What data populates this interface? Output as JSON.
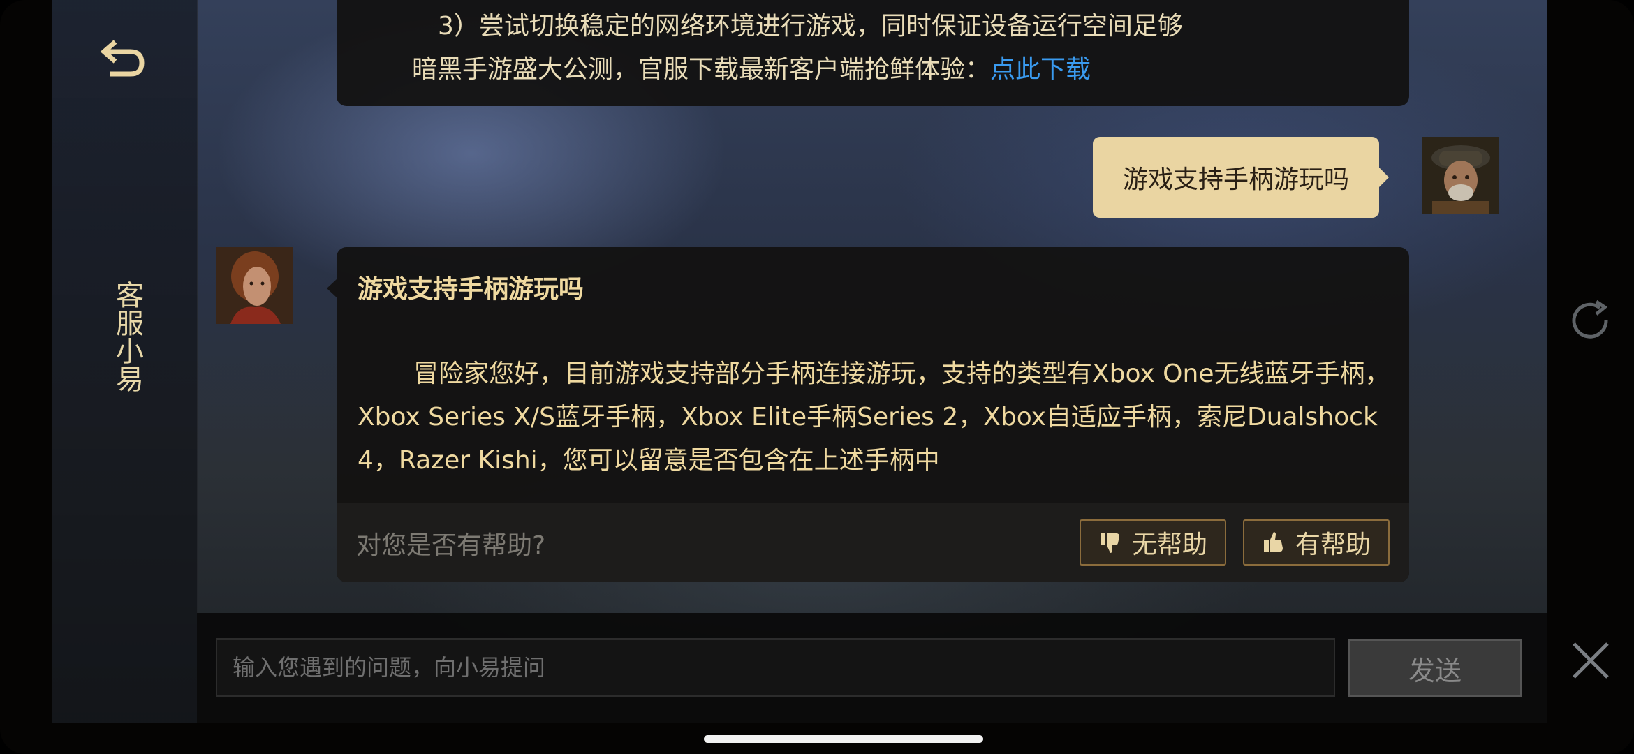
{
  "sidebar": {
    "title": "客服小易",
    "back_icon": "return-arrow-icon"
  },
  "previous_message": {
    "line1": "3）尝试切换稳定的网络环境进行游戏，同时保证设备运行空间足够",
    "line2_prefix": "暗黑手游盛大公测，官服下载最新客户端抢鲜体验：",
    "link_text": "点此下载",
    "link_color": "#3a9bf0"
  },
  "user_message": {
    "text": "游戏支持手柄游玩吗",
    "bubble_color": "#ead5a2"
  },
  "bot_message": {
    "title": "游戏支持手柄游玩吗",
    "answer": "冒险家您好，目前游戏支持部分手柄连接游玩，支持的类型有Xbox One无线蓝牙手柄，Xbox Series X/S蓝牙手柄，Xbox Elite手柄Series 2，Xbox自适应手柄，索尼Dualshock 4，Razer Kishi，您可以留意是否包含在上述手柄中",
    "text_color": "#efd9a0"
  },
  "feedback": {
    "question": "对您是否有帮助?",
    "unhelpful_label": "无帮助",
    "helpful_label": "有帮助",
    "unhelpful_icon": "thumbs-down-icon",
    "helpful_icon": "thumbs-up-icon"
  },
  "input": {
    "placeholder": "输入您遇到的问题，向小易提问",
    "send_label": "发送"
  },
  "side_icons": {
    "refresh": "refresh-icon",
    "close": "close-icon"
  }
}
